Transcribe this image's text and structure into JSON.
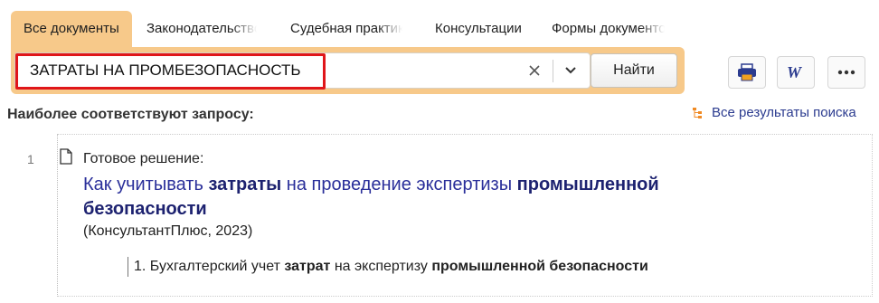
{
  "tabs": [
    {
      "label": "Все документы",
      "active": true
    },
    {
      "label": "Законодательство"
    },
    {
      "label": "Судебная практика"
    },
    {
      "label": "Консультации"
    },
    {
      "label": "Формы документов"
    }
  ],
  "search": {
    "query": "ЗАТРАТЫ НА ПРОМБЕЗОПАСНОСТЬ",
    "find_label": "Найти"
  },
  "tools": [
    "print-icon",
    "word-export-icon",
    "more-icon"
  ],
  "results": {
    "title": "Наиболее соответствуют запросу:",
    "all_link": "Все результаты поиска",
    "items": [
      {
        "number": "1",
        "kind": "Готовое решение:",
        "headline_parts": [
          "Как учитывать ",
          "затраты",
          " на проведение экспертизы ",
          "промышленной безопасности"
        ],
        "source": "(КонсультантПлюс, 2023)",
        "section_parts": [
          "1. Бухгалтерский учет ",
          "затрат",
          " на экспертизу ",
          "промышленной безопасности"
        ]
      }
    ]
  },
  "colors": {
    "accent": "#f7c98a",
    "link": "#2a2f9a",
    "highlight_border": "#e0161a"
  }
}
